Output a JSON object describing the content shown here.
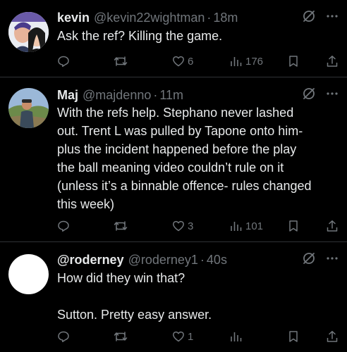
{
  "tweets": [
    {
      "name": "kevin",
      "handle": "@kevin22wightman",
      "time": "18m",
      "text": "Ask the ref? Killing the game.",
      "replies": "",
      "retweets": "",
      "likes": "6",
      "views": "176"
    },
    {
      "name": "Maj",
      "handle": "@majdenno",
      "time": "11m",
      "text": "With the refs help. Stephano never lashed\nout. Trent L was pulled by Tapone onto him-\nplus the incident happened before the play\nthe ball meaning video couldn’t rule on it\n(unless it’s a binnable offence- rules changed\nthis week)",
      "replies": "",
      "retweets": "",
      "likes": "3",
      "views": "101"
    },
    {
      "name": "@roderney",
      "handle": "@roderney1",
      "time": "40s",
      "text": "How did they win that?\n\nSutton. Pretty easy answer.",
      "replies": "",
      "retweets": "",
      "likes": "1",
      "views": ""
    }
  ],
  "separator": "·",
  "icons": [
    "grok-slash-icon",
    "more-icon",
    "reply-icon",
    "retweet-icon",
    "like-icon",
    "views-icon",
    "bookmark-icon",
    "share-icon"
  ],
  "colors": {
    "background": "#000000",
    "text": "#e7e9ea",
    "secondary": "#71767b",
    "divider": "#2f3336"
  }
}
